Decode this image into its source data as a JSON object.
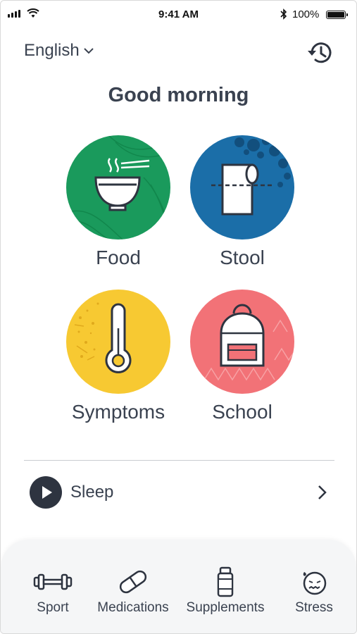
{
  "status_bar": {
    "time": "9:41 AM",
    "battery": "100%"
  },
  "header": {
    "language": "English",
    "greeting": "Good morning"
  },
  "tiles": [
    {
      "label": "Food",
      "color": "#1a9a5c",
      "icon": "bowl-icon"
    },
    {
      "label": "Stool",
      "color": "#1b6ea8",
      "icon": "toilet-paper-icon"
    },
    {
      "label": "Symptoms",
      "color": "#f7c932",
      "icon": "thermometer-icon"
    },
    {
      "label": "School",
      "color": "#f27277",
      "icon": "backpack-icon"
    }
  ],
  "sleep": {
    "label": "Sleep"
  },
  "bottom_nav": [
    {
      "label": "Sport",
      "icon": "dumbbell-icon"
    },
    {
      "label": "Medications",
      "icon": "pill-icon"
    },
    {
      "label": "Supplements",
      "icon": "bottle-icon"
    },
    {
      "label": "Stress",
      "icon": "stressed-face-icon"
    }
  ],
  "colors": {
    "text": "#3a4250",
    "dark": "#2e3440",
    "bottom_bg": "#f5f6f7"
  }
}
